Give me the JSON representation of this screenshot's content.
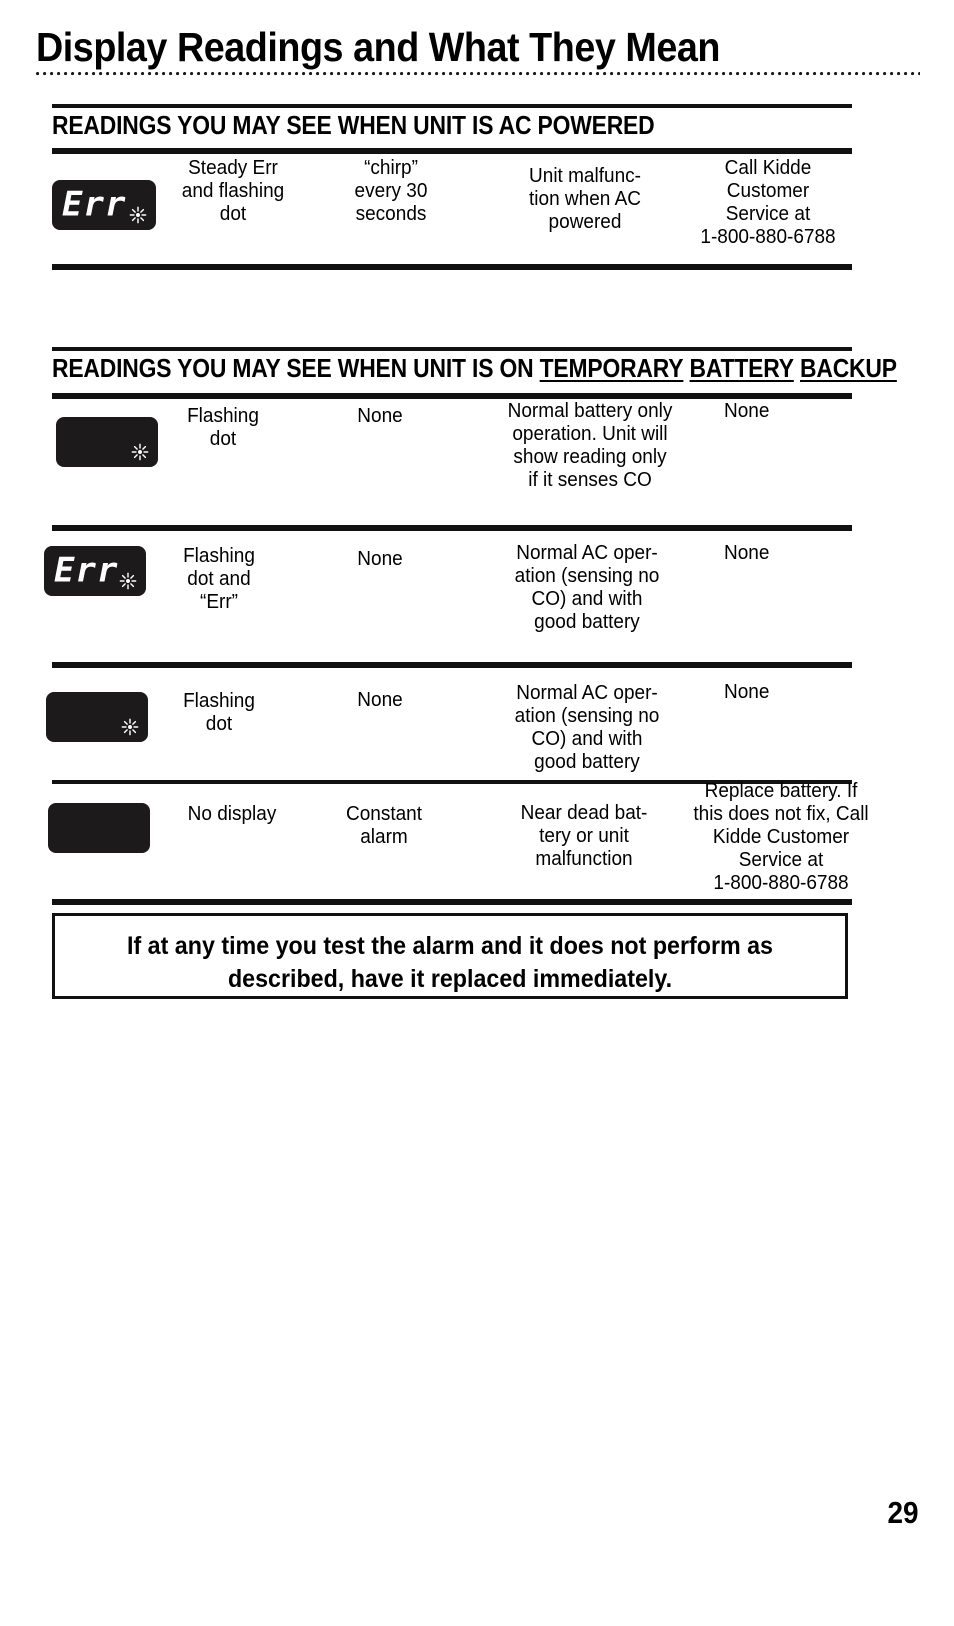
{
  "page": {
    "title": "Display Readings and What They Mean",
    "page_number": "29"
  },
  "sections": [
    {
      "id": "ac-powered",
      "heading_prefix": "READINGS YOU MAY SEE WHEN UNIT IS AC POWERED",
      "heading_underlined": [],
      "rows": [
        {
          "display": {
            "kind": "lcd",
            "digits": "Err",
            "dot_icon": "flashing-dot-icon",
            "has_dot": true
          },
          "reading": "Steady Err\nand flashing\ndot",
          "sound": "“chirp”\nevery 30\nseconds",
          "meaning": "Unit malfunc-\ntion when AC\npowered",
          "action": "Call Kidde\nCustomer\nService at\n1-800-880-6788"
        }
      ]
    },
    {
      "id": "battery-backup",
      "heading_prefix": "READINGS YOU MAY SEE WHEN UNIT IS ON ",
      "heading_underlined": [
        "TEMPORARY",
        "BATTERY",
        "BACKUP"
      ],
      "rows": [
        {
          "display": {
            "kind": "lcd",
            "digits": "",
            "dot_icon": "flashing-dot-icon",
            "has_dot": true
          },
          "reading": "Flashing\ndot",
          "sound": "None",
          "meaning": "Normal battery only\noperation. Unit will\nshow reading only\nif it senses CO",
          "action": "None"
        },
        {
          "display": {
            "kind": "lcd",
            "digits": "Err",
            "dot_icon": "flashing-dot-icon",
            "has_dot": true
          },
          "reading": "Flashing\ndot and\n“Err”",
          "sound": "None",
          "meaning": "Normal AC oper-\nation (sensing no\nCO) and with\ngood battery",
          "action": "None"
        },
        {
          "display": {
            "kind": "lcd",
            "digits": "",
            "dot_icon": "flashing-dot-icon",
            "has_dot": true
          },
          "reading": "Flashing\ndot",
          "sound": "None",
          "meaning": "Normal AC oper-\nation (sensing no\nCO) and with\ngood battery",
          "action": "None"
        },
        {
          "display": {
            "kind": "lcd",
            "digits": "",
            "dot_icon": "none",
            "has_dot": false
          },
          "reading": "No display",
          "sound": "Constant\nalarm",
          "meaning": "Near dead bat-\ntery or unit\nmalfunction",
          "action": "Replace battery.  If\nthis does not fix, Call\nKidde Customer\nService at\n1-800-880-6788"
        }
      ]
    }
  ],
  "notice": {
    "line1": "If at any time you test the alarm and it does not perform as",
    "line2": "described, have it replaced immediately."
  },
  "colors": {
    "ink": "#000000",
    "rule": "#111111",
    "lcd_background": "#1c1a1a",
    "lcd_segment": "#ffffff"
  }
}
